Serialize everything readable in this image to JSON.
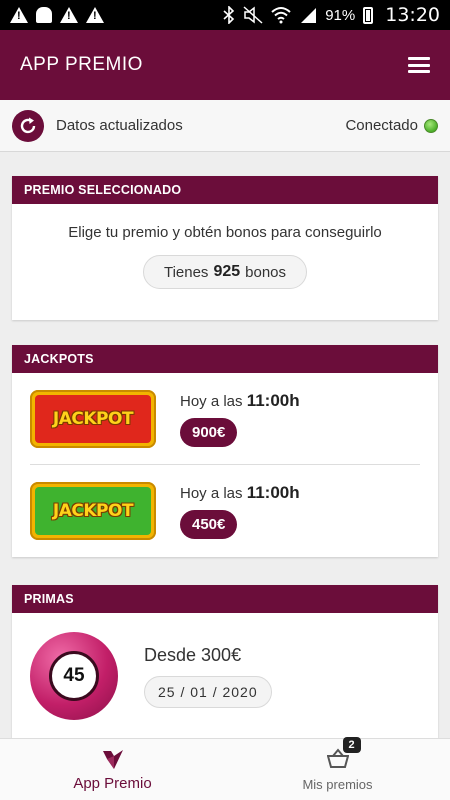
{
  "status_bar": {
    "battery": "91%",
    "time": "13:20"
  },
  "app_bar": {
    "title": "APP PREMIO",
    "menu_icon": "menu-icon"
  },
  "update_bar": {
    "label": "Datos actualizados",
    "connection": "Conectado",
    "connection_color": "#4caf2a"
  },
  "premio_card": {
    "header": "PREMIO SELECCIONADO",
    "text": "Elige tu premio y obtén bonos para conseguirlo",
    "bonos_prefix": "Tienes",
    "bonos_value": "925",
    "bonos_suffix": "bonos"
  },
  "jackpots_card": {
    "header": "JACKPOTS",
    "items": [
      {
        "image_text": "JACKPOT",
        "time_prefix": "Hoy a las",
        "time": "11:00h",
        "amount": "900€",
        "color": "red"
      },
      {
        "image_text": "JACKPOT",
        "time_prefix": "Hoy a las",
        "time": "11:00h",
        "amount": "450€",
        "color": "green"
      }
    ]
  },
  "primas_card": {
    "header": "PRIMAS",
    "ball_number": "45",
    "desde": "Desde 300€",
    "date": "25 / 01 / 2020"
  },
  "bottom_nav": {
    "items": [
      {
        "label": "App Premio",
        "icon": "app-premio-logo-icon",
        "active": true
      },
      {
        "label": "Mis premios",
        "icon": "basket-icon",
        "badge": "2",
        "active": false
      }
    ]
  },
  "colors": {
    "brand": "#6b0d3a",
    "background": "#eeeeee"
  }
}
